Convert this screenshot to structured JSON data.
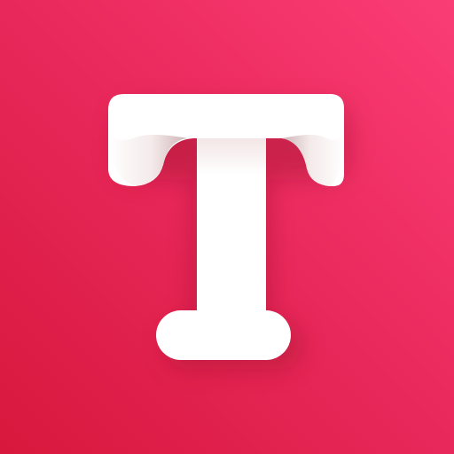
{
  "icon": {
    "name": "T letter logo",
    "glyph": "letter-t-icon",
    "colors": {
      "background_light": "#fb3d76",
      "background_mid": "#e8285a",
      "background_dark": "#d8183c",
      "letter": "#ffffff",
      "letter_shade": "#f1e4e4",
      "curl_shadow": "#c9a9ad"
    }
  }
}
